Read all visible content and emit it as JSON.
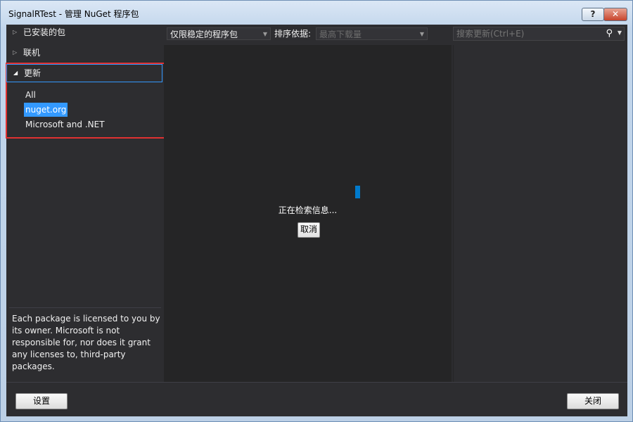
{
  "window": {
    "title": "SignalRTest - 管理 NuGet 程序包",
    "help_label": "?",
    "close_label": "✕"
  },
  "sidebar": {
    "installed_label": "已安装的包",
    "online_label": "联机",
    "updates_label": "更新",
    "update_sources": [
      "All",
      "nuget.org",
      "Microsoft and .NET"
    ],
    "selected_source": "nuget.org",
    "license_text": "Each package is licensed to you by its owner. Microsoft is not responsible for, nor does it grant any licenses to, third-party packages."
  },
  "toolbar": {
    "filter_value": "仅限稳定的程序包",
    "sort_label": "排序依据:",
    "sort_value": "最高下载量"
  },
  "list": {
    "loading_text": "正在检索信息...",
    "cancel_label": "取消"
  },
  "search": {
    "placeholder": "搜索更新(Ctrl+E)"
  },
  "footer": {
    "settings_label": "设置",
    "close_label": "关闭"
  },
  "colors": {
    "accent": "#3399ff",
    "highlight_box": "#e03131",
    "spinner": "#007acc",
    "panel": "#2d2d30"
  }
}
